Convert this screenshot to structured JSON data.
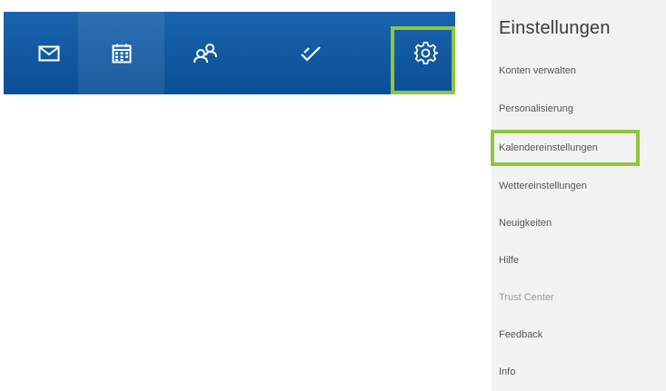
{
  "nav": {
    "background": "#0e5aa6",
    "items": [
      {
        "name": "mail",
        "icon": "envelope-icon"
      },
      {
        "name": "calendar",
        "icon": "calendar-icon",
        "active": true
      },
      {
        "name": "people",
        "icon": "people-icon"
      },
      {
        "name": "tasks",
        "icon": "checkmark-icon"
      },
      {
        "name": "settings",
        "icon": "gear-icon",
        "highlighted": true
      }
    ]
  },
  "settings": {
    "title": "Einstellungen",
    "items": [
      "Konten verwalten",
      "Personalisierung",
      "Kalendereinstellungen",
      "Wettereinstellungen",
      "Neuigkeiten",
      "Hilfe",
      "Trust Center",
      "Feedback",
      "Info"
    ],
    "highlighted_item": "Kalendereinstellungen"
  },
  "highlight_color": "#8dc63f"
}
